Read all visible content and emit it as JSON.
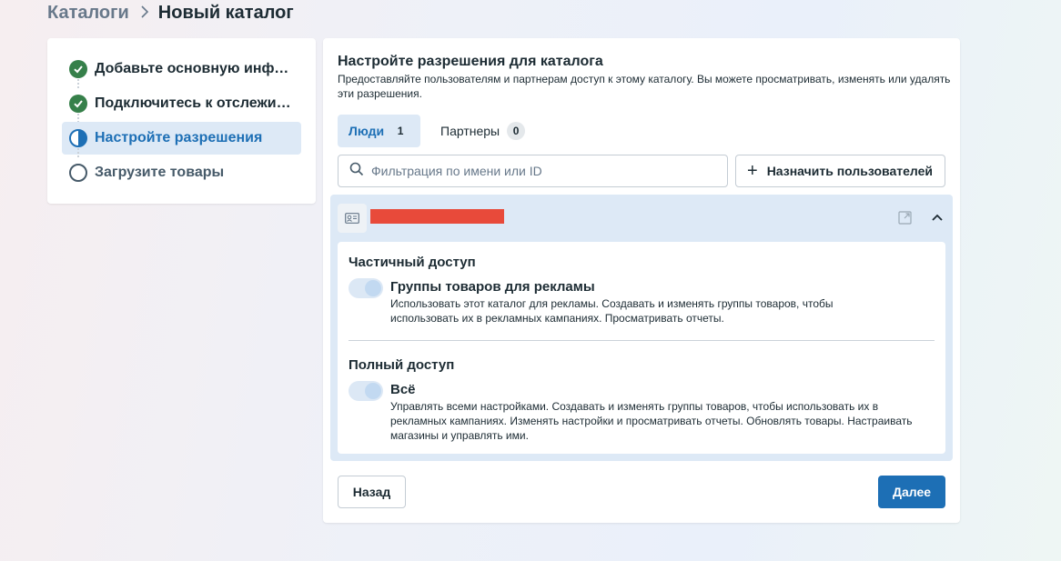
{
  "breadcrumb": {
    "parent": "Каталоги",
    "separator": ">",
    "current": "Новый каталог"
  },
  "steps": [
    {
      "label": "Добавьте основную информацию",
      "status": "done"
    },
    {
      "label": "Подключитесь к отслеживанию",
      "status": "done"
    },
    {
      "label": "Настройте разрешения",
      "status": "active"
    },
    {
      "label": "Загрузите товары",
      "status": "todo"
    }
  ],
  "main": {
    "title": "Настройте разрешения для каталога",
    "description": "Предоставляйте пользователям и партнерам доступ к этому каталогу. Вы можете просматривать, изменять или удалять эти разрешения.",
    "tabs": [
      {
        "label": "Люди",
        "count": "1"
      },
      {
        "label": "Партнеры",
        "count": "0"
      }
    ],
    "search": {
      "placeholder": "Фильтрация по имени или ID"
    },
    "assign_button": "Назначить пользователей"
  },
  "user_panel": {
    "sections": [
      {
        "title": "Частичный доступ",
        "option_title": "Группы товаров для рекламы",
        "option_desc": "Использовать этот каталог для рекламы. Создавать и изменять группы товаров, чтобы использовать их в рекламных кампаниях. Просматривать отчеты."
      },
      {
        "title": "Полный доступ",
        "option_title": "Всё",
        "option_desc": "Управлять всеми настройками. Создавать и изменять группы товаров, чтобы использовать их в рекламных кампаниях. Изменять настройки и просматривать отчеты. Обновлять товары. Настраивать магазины и управлять ими."
      }
    ]
  },
  "footer": {
    "back_label": "Назад",
    "next_label": "Далее"
  },
  "colors": {
    "accent": "#1d6fb5",
    "done": "#36804a",
    "redaction": "#e84a3a"
  }
}
